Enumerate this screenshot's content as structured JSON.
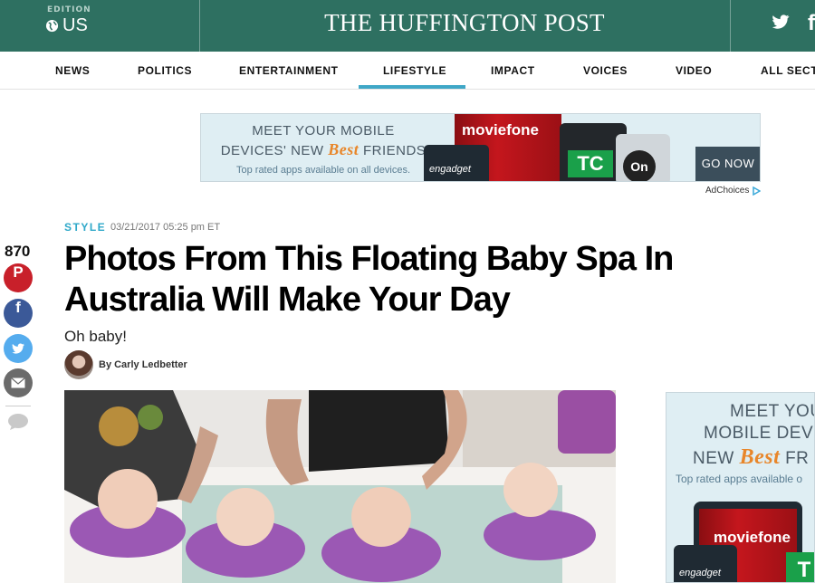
{
  "masthead": {
    "edition_label": "EDITION",
    "edition_value": "US",
    "site_title": "THE HUFFINGTON POST"
  },
  "nav": {
    "items": [
      "NEWS",
      "POLITICS",
      "ENTERTAINMENT",
      "LIFESTYLE",
      "IMPACT",
      "VOICES",
      "VIDEO",
      "ALL SECTI"
    ],
    "active": "LIFESTYLE"
  },
  "banner_ad": {
    "line1": "MEET YOUR MOBILE",
    "line2_pre": "DEVICES' NEW",
    "line2_best": "Best",
    "line2_post": "FRIENDS",
    "tagline": "Top rated apps available on all devices.",
    "moviefone": "moviefone",
    "engadget": "engadget",
    "tc": "TC",
    "on": "On",
    "cta": "GO NOW"
  },
  "adchoices": "AdChoices",
  "share": {
    "count": "870",
    "icons": [
      "pinterest-icon",
      "facebook-icon",
      "twitter-icon",
      "email-icon",
      "comment-icon"
    ]
  },
  "article": {
    "section": "STYLE",
    "timestamp": "03/21/2017 05:25 pm ET",
    "headline": "Photos From This Floating Baby Spa In Australia Will Make Your Day",
    "subhead": "Oh baby!",
    "byline": "By Carly Ledbetter"
  },
  "side_ad": {
    "line1": "MEET YOU",
    "line2": "MOBILE DEVI",
    "line3_pre": "NEW",
    "line3_best": "Best",
    "line3_post": "FR",
    "tagline": "Top rated apps available o",
    "moviefone": "moviefone",
    "engadget": "engadget",
    "tc": "T"
  },
  "colors": {
    "masthead": "#2e7061",
    "nav_active_underline": "#3fa7c7",
    "section_label": "#2ea8c9",
    "pinterest": "#c8202a",
    "facebook": "#3b5998",
    "twitter": "#55acee",
    "email": "#6b6b6b"
  }
}
